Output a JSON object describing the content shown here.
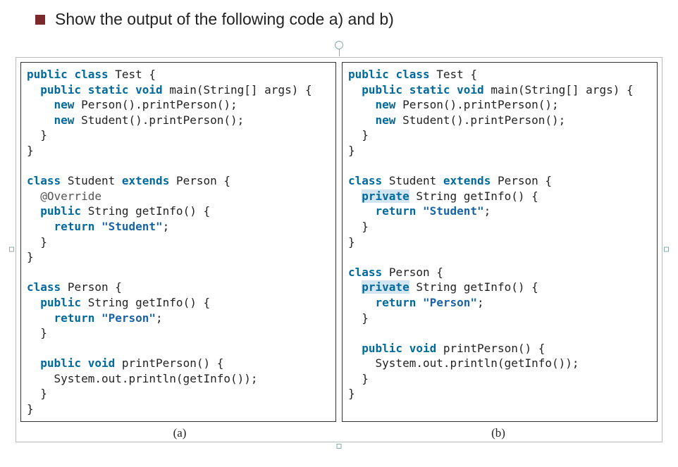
{
  "question": "Show the output of the following code a) and b)",
  "labels": {
    "a": "(a)",
    "b": "(b)"
  },
  "code_a": {
    "kw_public1": "public",
    "kw_class1": "class",
    "name_test": "Test {",
    "kw_public2": "public",
    "kw_static": "static",
    "kw_void1": "void",
    "main_sig": "main(String[] args) {",
    "kw_new1": "new",
    "line_newPerson": "Person().printPerson();",
    "kw_new2": "new",
    "line_newStudent": "Student().printPerson();",
    "brace_close1": "  }",
    "brace_close2": "}",
    "kw_class2": "class",
    "student_decl1": "Student",
    "kw_extends": "extends",
    "student_decl2": "Person {",
    "override": "@Override",
    "kw_public3": "public",
    "getinfo_sig1": "String getInfo() {",
    "kw_return1": "return",
    "str_student": "\"Student\"",
    "semi1": ";",
    "brace_close3": "  }",
    "brace_close4": "}",
    "kw_class3": "class",
    "person_decl": "Person {",
    "kw_public4": "public",
    "getinfo_sig2": "String getInfo() {",
    "kw_return2": "return",
    "str_person": "\"Person\"",
    "semi2": ";",
    "brace_close5": "  }",
    "kw_public5": "public",
    "kw_void2": "void",
    "print_sig": "printPerson() {",
    "print_body": "    System.out.println(getInfo());",
    "brace_close6": "  }",
    "brace_close7": "}"
  },
  "code_b": {
    "kw_public1": "public",
    "kw_class1": "class",
    "name_test": "Test {",
    "kw_public2": "public",
    "kw_static": "static",
    "kw_void1": "void",
    "main_sig": "main(String[] args) {",
    "kw_new1": "new",
    "line_newPerson": "Person().printPerson();",
    "kw_new2": "new",
    "line_newStudent": "Student().printPerson();",
    "brace_close1": "  }",
    "brace_close2": "}",
    "kw_class2": "class",
    "student_decl1": "Student",
    "kw_extends": "extends",
    "student_decl2": "Person {",
    "kw_private1": "private",
    "getinfo_sig1": "String getInfo() {",
    "kw_return1": "return",
    "str_student": "\"Student\"",
    "semi1": ";",
    "brace_close3": "  }",
    "brace_close4": "}",
    "kw_class3": "class",
    "person_decl": "Person {",
    "kw_private2": "private",
    "getinfo_sig2": "String getInfo() {",
    "kw_return2": "return",
    "str_person": "\"Person\"",
    "semi2": ";",
    "brace_close5": "  }",
    "kw_public5": "public",
    "kw_void2": "void",
    "print_sig": "printPerson() {",
    "print_body": "    System.out.println(getInfo());",
    "brace_close6": "  }",
    "brace_close7": "}"
  }
}
